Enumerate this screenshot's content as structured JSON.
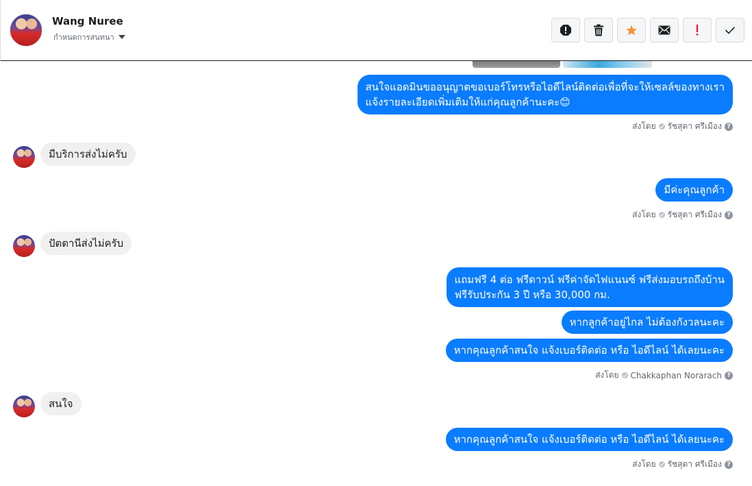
{
  "header": {
    "name": "Wang Nuree",
    "subtitle": "กำหนดการสนทนา"
  },
  "toolbar": {
    "buttons": [
      {
        "name": "report-icon",
        "color": "#1c1e21"
      },
      {
        "name": "trash-icon",
        "color": "#1c1e21"
      },
      {
        "name": "star-icon",
        "color": "#f7923b"
      },
      {
        "name": "envelope-icon",
        "color": "#1c1e21"
      },
      {
        "name": "exclamation-icon",
        "color": "#e41e3f"
      },
      {
        "name": "checkmark-icon",
        "color": "#1c1e21"
      }
    ]
  },
  "messages": {
    "m1_line1": "สนใจแอดมินขออนุญาตขอเบอร์โทรหรือไอดีไลน์ติดต่อเพื่อที่จะให้เซลล์ของทางเรา",
    "m1_line2": "แจ้งรายละเอียดเพิ่มเติมให้แก่คุณลูกค้านะคะ😊",
    "meta1_prefix": "ส่งโดย",
    "meta1_sender": "รัชสุดา ศรีเมือง",
    "m2": "มีบริการส่งไม่ครับ",
    "m3": "มีค่ะคุณลูกค้า",
    "meta2_prefix": "ส่งโดย",
    "meta2_sender": "รัชสุดา ศรีเมือง",
    "m4": "ปัตตานีส่งไม่ครับ",
    "m5_line1": "แถมฟรี 4 ต่อ ฟรีดาวน์ ฟรีค่าจัดไฟแนนซ์ ฟรีส่งมอบรถถึงบ้าน",
    "m5_line2": "ฟรีรับประกัน 3 ปี หรือ 30,000 กม.",
    "m6": "หากลูกค้าอยู่ไกล ไม่ต้องกังวลนะคะ",
    "m7": "หากคุณลูกค้าสนใจ แจ้งเบอร์ติดต่อ หรือ ไอดีไลน์ ได้เลยนะคะ",
    "meta3_prefix": "ส่งโดย",
    "meta3_sender": "Chakkaphan Norarach",
    "m8": "สนใจ",
    "m9": "หากคุณลูกค้าสนใจ แจ้งเบอร์ติดต่อ หรือ ไอดีไลน์ ได้เลยนะคะ",
    "meta4_prefix": "ส่งโดย",
    "meta4_sender": "รัชสุดา ศรีเมือง",
    "help_glyph": "?"
  }
}
